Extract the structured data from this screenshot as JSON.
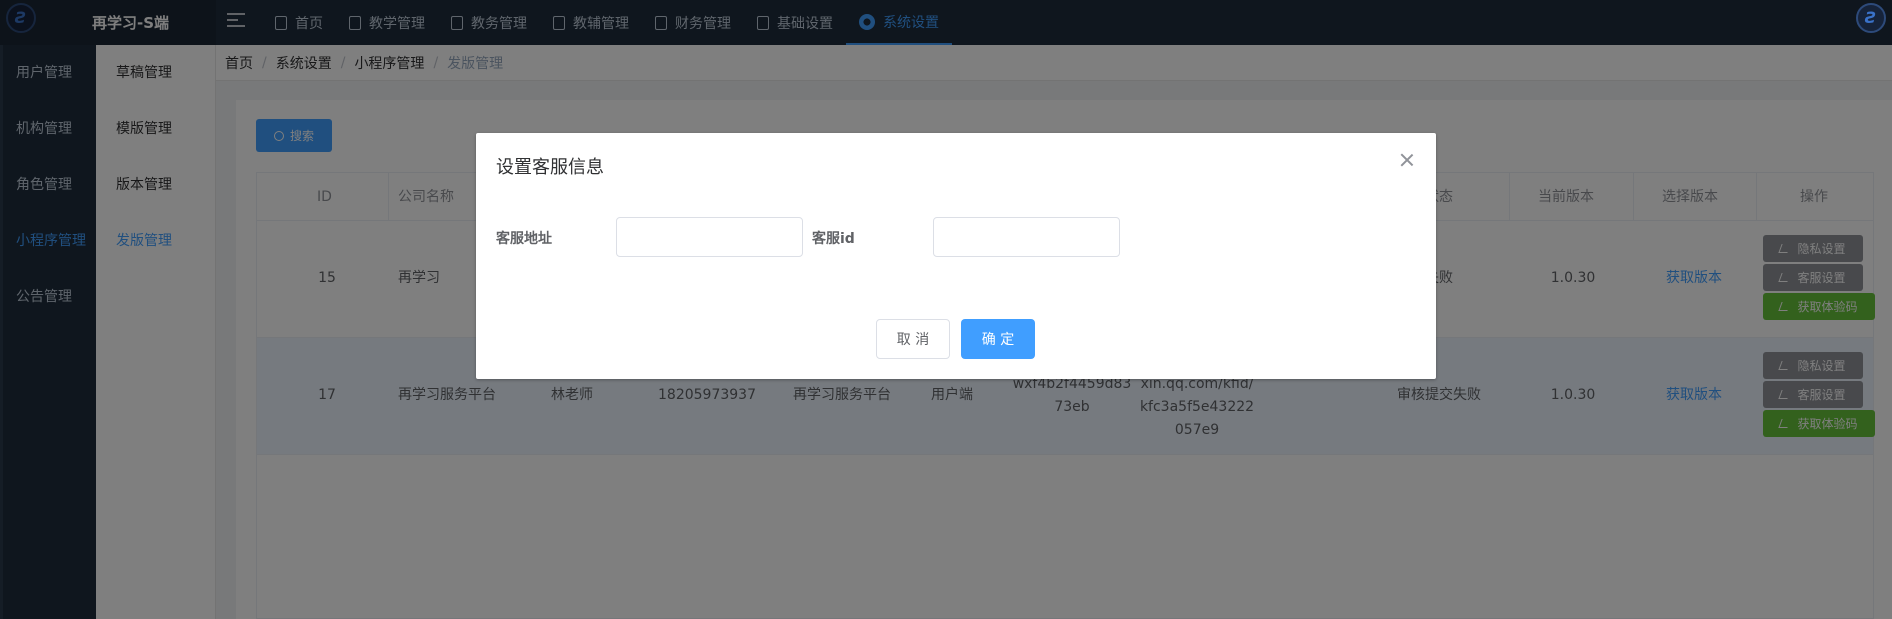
{
  "app": {
    "title": "再学习-S端"
  },
  "topnav": {
    "items": [
      {
        "label": "首页"
      },
      {
        "label": "教学管理"
      },
      {
        "label": "教务管理"
      },
      {
        "label": "教辅管理"
      },
      {
        "label": "财务管理"
      },
      {
        "label": "基础设置"
      },
      {
        "label": "系统设置",
        "active": true
      }
    ]
  },
  "sidebar_primary": {
    "items": [
      {
        "label": "用户管理"
      },
      {
        "label": "机构管理"
      },
      {
        "label": "角色管理"
      },
      {
        "label": "小程序管理",
        "active": true
      },
      {
        "label": "公告管理"
      }
    ]
  },
  "sidebar_secondary": {
    "items": [
      {
        "label": "草稿管理"
      },
      {
        "label": "模版管理"
      },
      {
        "label": "版本管理"
      },
      {
        "label": "发版管理",
        "active": true
      }
    ]
  },
  "breadcrumb": [
    "首页",
    "系统设置",
    "小程序管理",
    "发版管理"
  ],
  "toolbar": {
    "search_label": "搜索"
  },
  "table": {
    "headers": {
      "id": "ID",
      "company": "公司名称",
      "status": "状态",
      "status_visible_fragment": "审核状态",
      "current_version": "当前版本",
      "select_version": "选择版本",
      "actions": "操作"
    },
    "rows": [
      {
        "id": "15",
        "company": "再学习",
        "status": "审核提交失败",
        "status_visible": "提交失败",
        "current_version": "1.0.30",
        "select_version": "获取版本"
      },
      {
        "id": "17",
        "company": "再学习服务平台",
        "contact": "林老师",
        "phone": "18205973937",
        "app_name": "再学习服务平台",
        "client": "用户端",
        "appid_line1": "wxf4b2f4459d83",
        "appid_line2": "73eb",
        "url_line1": "xin.qq.com/kfid/",
        "url_line2": "kfc3a5f5e43222",
        "url_line3": "057e9",
        "status": "审核提交失败",
        "current_version": "1.0.30",
        "select_version": "获取版本"
      }
    ],
    "row_actions": {
      "privacy": "隐私设置",
      "service": "客服设置",
      "qrcode": "获取体验码"
    }
  },
  "dialog": {
    "title": "设置客服信息",
    "field_url_label": "客服地址",
    "field_url_value": "",
    "field_id_label": "客服id",
    "field_id_value": "",
    "cancel_label": "取 消",
    "confirm_label": "确 定"
  },
  "colors": {
    "primary": "#409eff",
    "nav_bg": "#1f2d3d",
    "success": "#67c23a",
    "info": "#909399"
  }
}
